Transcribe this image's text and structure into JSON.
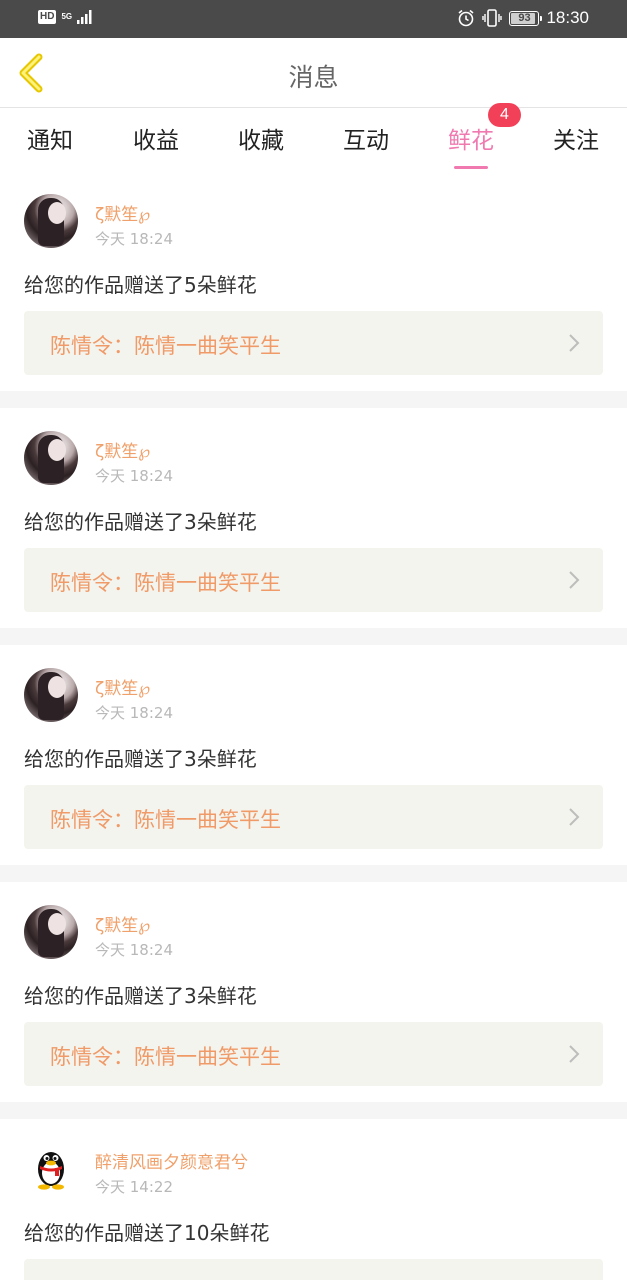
{
  "status_bar": {
    "hd": "HD",
    "network": "5G",
    "battery": "93",
    "battery_level_percent": 93,
    "time": "18:30",
    "icons": [
      "hd-icon",
      "signal-icon",
      "alarm-icon",
      "vibrate-icon",
      "battery-icon"
    ]
  },
  "header": {
    "title": "消息",
    "back_icon": "chevron-left-icon"
  },
  "tabs": [
    {
      "label": "通知"
    },
    {
      "label": "收益"
    },
    {
      "label": "收藏"
    },
    {
      "label": "互动"
    },
    {
      "label": "鲜花",
      "active": true,
      "badge": "4"
    },
    {
      "label": "关注"
    }
  ],
  "colors": {
    "accent": "#f07ab0",
    "badge": "#f24058",
    "username": "#f0a06a",
    "link": "#f09a68",
    "link_bg": "#f4f4ee"
  },
  "messages": [
    {
      "user": "ζ默笙℘",
      "time": "今天 18:24",
      "text": "给您的作品赠送了5朵鲜花",
      "work": "陈情令：陈情一曲笑平生",
      "avatar": "photo"
    },
    {
      "user": "ζ默笙℘",
      "time": "今天 18:24",
      "text": "给您的作品赠送了3朵鲜花",
      "work": "陈情令：陈情一曲笑平生",
      "avatar": "photo"
    },
    {
      "user": "ζ默笙℘",
      "time": "今天 18:24",
      "text": "给您的作品赠送了3朵鲜花",
      "work": "陈情令：陈情一曲笑平生",
      "avatar": "photo"
    },
    {
      "user": "ζ默笙℘",
      "time": "今天 18:24",
      "text": "给您的作品赠送了3朵鲜花",
      "work": "陈情令：陈情一曲笑平生",
      "avatar": "photo"
    },
    {
      "user": "醉清风画夕颜意君兮",
      "time": "今天 14:22",
      "text": "给您的作品赠送了10朵鲜花",
      "work": "",
      "avatar": "qq-penguin"
    }
  ]
}
